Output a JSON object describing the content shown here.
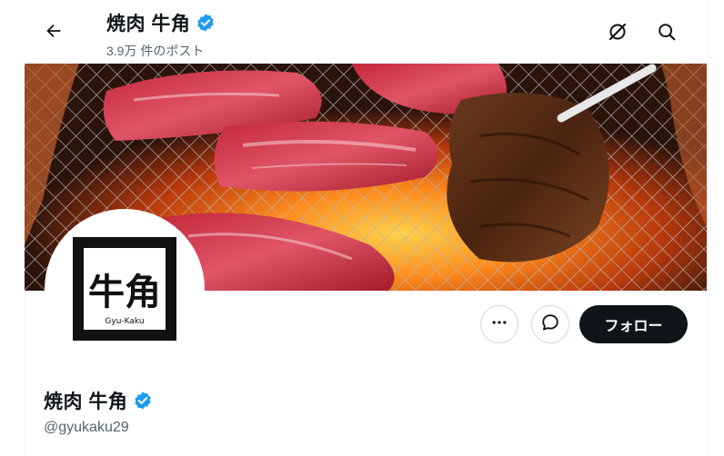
{
  "header": {
    "title": "焼肉 牛角",
    "post_count": "3.9万 件のポスト"
  },
  "icons": {
    "back": "arrow-left-icon",
    "grok": "grok-icon",
    "search": "search-icon",
    "verified": "verified-badge-icon",
    "more": "more-dots-icon",
    "message": "message-icon"
  },
  "colors": {
    "verified": "#1d9bf0",
    "follow_bg": "#0f1419",
    "secondary_text": "#536471"
  },
  "avatar": {
    "logo_text": "牛角",
    "logo_subtext": "Gyu-Kaku"
  },
  "actions": {
    "follow_label": "フォロー"
  },
  "profile": {
    "name": "焼肉 牛角",
    "handle": "@gyukaku29"
  }
}
